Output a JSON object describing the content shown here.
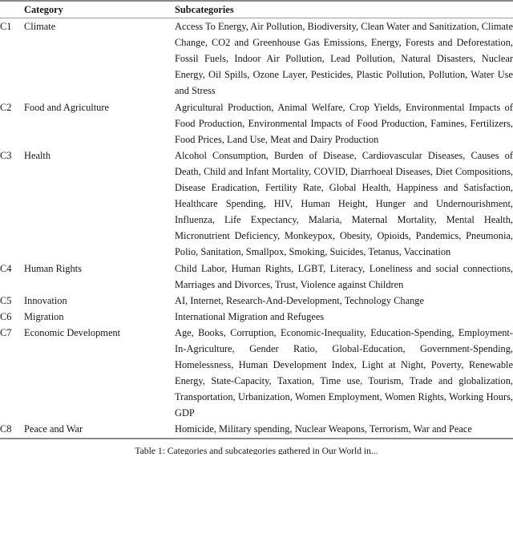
{
  "table": {
    "headers": {
      "id_col": "",
      "category": "Category",
      "subcategories": "Subcategories"
    },
    "rows": [
      {
        "id": "C1",
        "name": "Climate",
        "subcategories": "Access To Energy, Air Pollution, Biodiversity, Clean Water and Sanitization, Climate Change, CO2 and Greenhouse Gas Emissions, Energy, Forests and Deforestation, Fossil Fuels, Indoor Air Pollution, Lead Pollution, Natural Disasters, Nuclear Energy, Oil Spills, Ozone Layer, Pesticides, Plastic Pollution, Pollution, Water Use and Stress"
      },
      {
        "id": "C2",
        "name": "Food and Agriculture",
        "subcategories": "Agricultural Production, Animal Welfare, Crop Yields, Environmental Impacts of Food Production, Environmental Impacts of Food Production, Famines, Fertilizers, Food Prices, Land Use, Meat and Dairy Production"
      },
      {
        "id": "C3",
        "name": "Health",
        "subcategories": "Alcohol Consumption, Burden of Disease, Cardiovascular Diseases, Causes of Death, Child and Infant Mortality, COVID, Diarrhoeal Diseases, Diet Compositions, Disease Eradication, Fertility Rate, Global Health, Happiness and Satisfaction, Healthcare Spending, HIV, Human Height, Hunger and Undernourishment, Influenza, Life Expectancy, Malaria, Maternal Mortality, Mental Health, Micronutrient Deficiency, Monkeypox, Obesity, Opioids, Pandemics, Pneumonia, Polio, Sanitation, Smallpox, Smoking, Suicides, Tetanus, Vaccination"
      },
      {
        "id": "C4",
        "name": "Human Rights",
        "subcategories": "Child Labor, Human Rights, LGBT, Literacy, Loneliness and social connections, Marriages and Divorces, Trust, Violence against Children"
      },
      {
        "id": "C5",
        "name": "Innovation",
        "subcategories": "AI, Internet, Research-And-Development, Technology Change"
      },
      {
        "id": "C6",
        "name": "Migration",
        "subcategories": "International Migration and Refugees"
      },
      {
        "id": "C7",
        "name": "Economic Development",
        "subcategories": "Age, Books, Corruption, Economic-Inequality, Education-Spending, Employment-In-Agriculture, Gender Ratio, Global-Education, Government-Spending, Homelessness, Human Development Index, Light at Night, Poverty, Renewable Energy, State-Capacity, Taxation, Time use, Tourism, Trade and globalization, Transportation, Urbanization, Women Employment, Women Rights, Working Hours, GDP"
      },
      {
        "id": "C8",
        "name": "Peace and War",
        "subcategories": "Homicide, Military spending, Nuclear Weapons, Terrorism, War and Peace"
      }
    ]
  },
  "caption": "Table 1: Categories and subcategories gathered in Our World in..."
}
